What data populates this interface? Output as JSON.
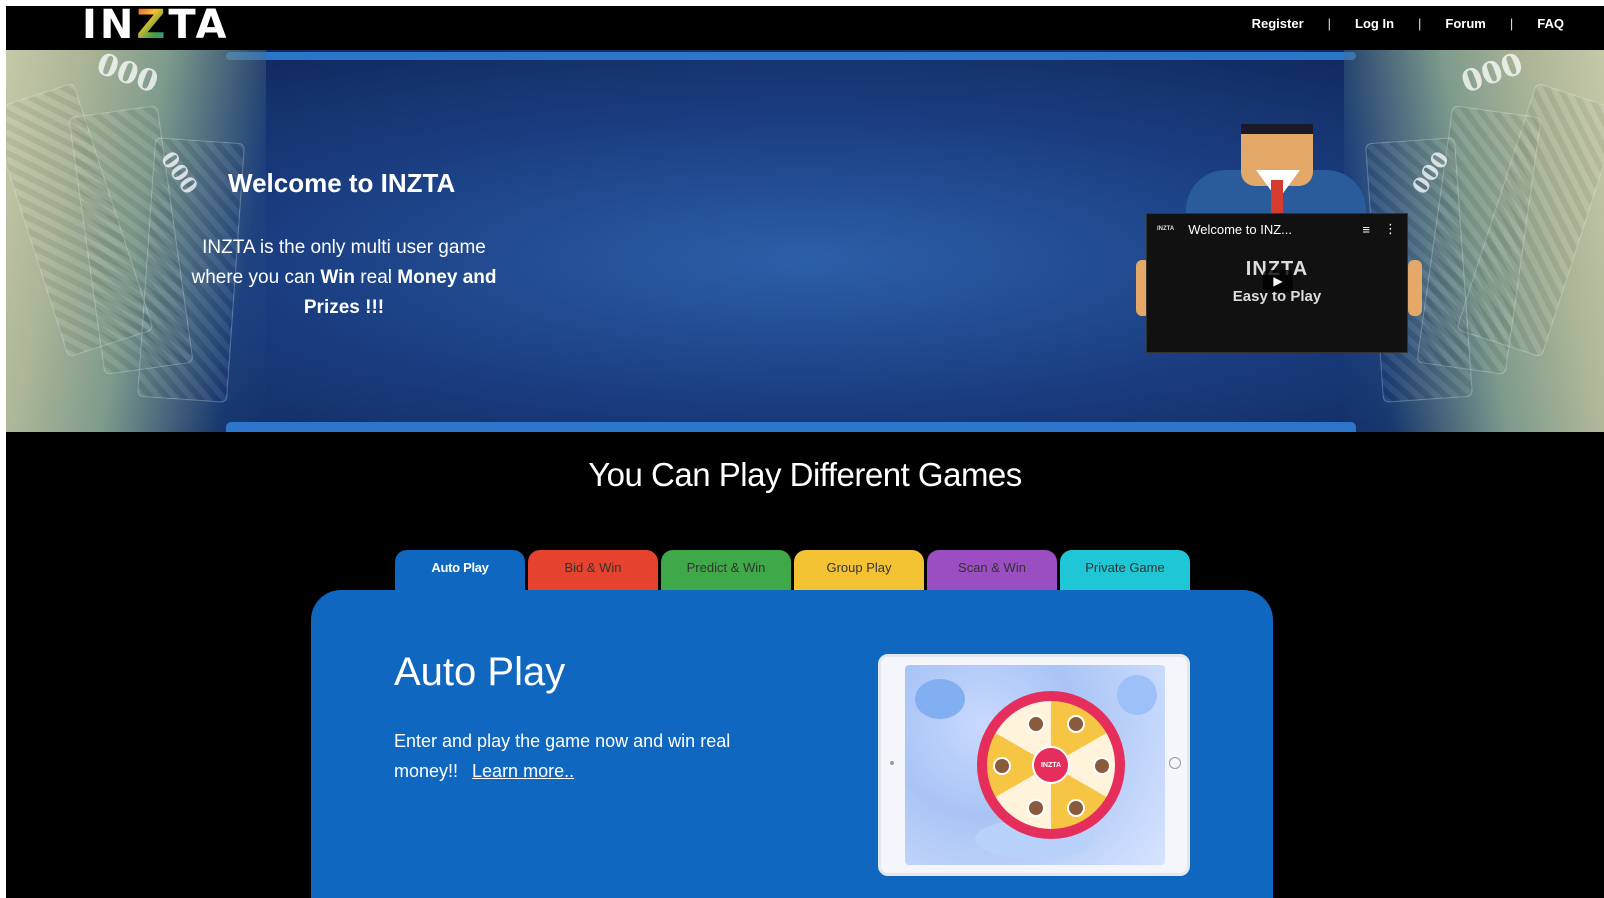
{
  "brand": {
    "logo_text_start": "IN",
    "logo_text_z": "Z",
    "logo_text_end": "TA"
  },
  "nav": {
    "items": [
      {
        "label": "Register"
      },
      {
        "label": "Log In"
      },
      {
        "label": "Forum"
      },
      {
        "label": "FAQ"
      }
    ],
    "separator": "|"
  },
  "hero": {
    "title": "Welcome to INZTA",
    "text_part1": "INZTA is the only multi user game where you can ",
    "text_bold1": "Win",
    "text_part2": " real ",
    "text_bold2": "Money and Prizes !!!",
    "note_numbers": [
      "000",
      "000",
      "000",
      "000"
    ],
    "video": {
      "channel_logo": "INZTA",
      "title": "Welcome to INZ...",
      "big_title": "INZTA",
      "subtitle": "Easy to Play"
    }
  },
  "games": {
    "heading": "You Can Play Different Games",
    "tabs": [
      {
        "label": "Auto Play",
        "color": "#0f67c0",
        "active": true
      },
      {
        "label": "Bid & Win",
        "color": "#e5432f",
        "active": false
      },
      {
        "label": "Predict & Win",
        "color": "#3fa94a",
        "active": false
      },
      {
        "label": "Group Play",
        "color": "#f3c333",
        "active": false
      },
      {
        "label": "Scan & Win",
        "color": "#9a4ec2",
        "active": false
      },
      {
        "label": "Private Game",
        "color": "#1ec6d6",
        "active": false
      }
    ],
    "panel": {
      "title": "Auto Play",
      "text": "Enter and play the game now and win real money!!",
      "link": "Learn more..",
      "wheel_hub_text": "INZTA"
    }
  },
  "colors": {
    "accent": "#0f67c0",
    "background": "#000000",
    "hero_blue": "#1b3f83"
  }
}
